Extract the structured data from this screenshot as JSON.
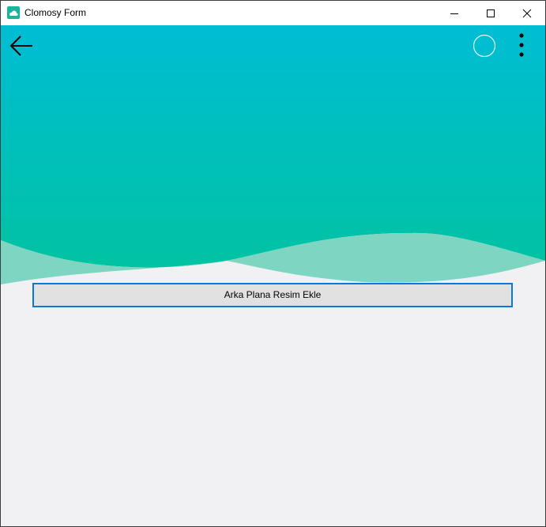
{
  "window": {
    "title": "Clomosy Form",
    "icon": "clomosy-app-icon",
    "controls": {
      "minimize_icon": "minimize-icon",
      "maximize_icon": "maximize-icon",
      "close_icon": "close-icon"
    }
  },
  "header": {
    "back_icon": "arrow-left-icon",
    "circle_icon": "circle-icon",
    "menu_icon": "more-vertical-icon",
    "gradient_top": "#00bdd3",
    "gradient_bottom": "#00c3a3",
    "wave_color": "#7dd5c2"
  },
  "main": {
    "add_background_button": "Arka Plana Resim Ekle",
    "background_color": "#f1f1f3",
    "focus_border_color": "#0a78d4"
  }
}
